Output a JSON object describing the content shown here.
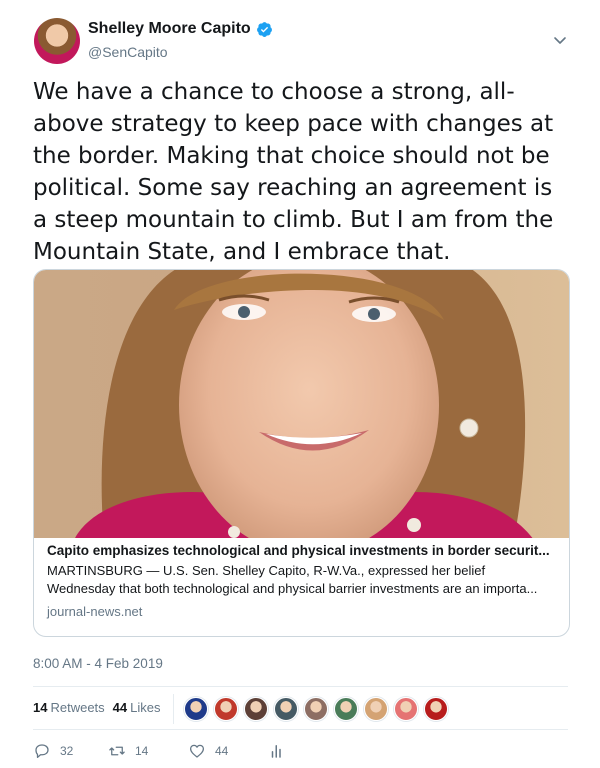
{
  "author": {
    "name": "Shelley Moore Capito",
    "handle": "@SenCapito",
    "verified": true
  },
  "tweet": {
    "text": "We have a chance to choose a strong, all-\nabove strategy to keep pace with changes at\nthe border. Making that choice should not be\npolitical. Some say reaching an agreement is\na steep mountain to climb. But I am from the\nMountain State, and I embrace that."
  },
  "card": {
    "title": "Capito emphasizes technological and physical investments in border securit...",
    "description": "MARTINSBURG — U.S. Sen. Shelley Capito, R-W.Va., expressed her belief Wednesday that both technological and physical barrier investments are an importa...",
    "domain": "journal-news.net"
  },
  "timestamp": "8:00 AM - 4 Feb 2019",
  "stats": {
    "retweets_count": "14",
    "retweets_label": "Retweets",
    "likes_count": "44",
    "likes_label": "Likes"
  },
  "likers": [
    "#1e3a8a",
    "#c0392b",
    "#5d4037",
    "#455a64",
    "#8d6e63",
    "#4a7c59",
    "#d4a373",
    "#e57373",
    "#b71c1c"
  ],
  "actions": {
    "reply_count": "32",
    "retweet_count": "14",
    "like_count": "44"
  },
  "colors": {
    "verified": "#1da1f2",
    "secondary_text": "#657786"
  }
}
